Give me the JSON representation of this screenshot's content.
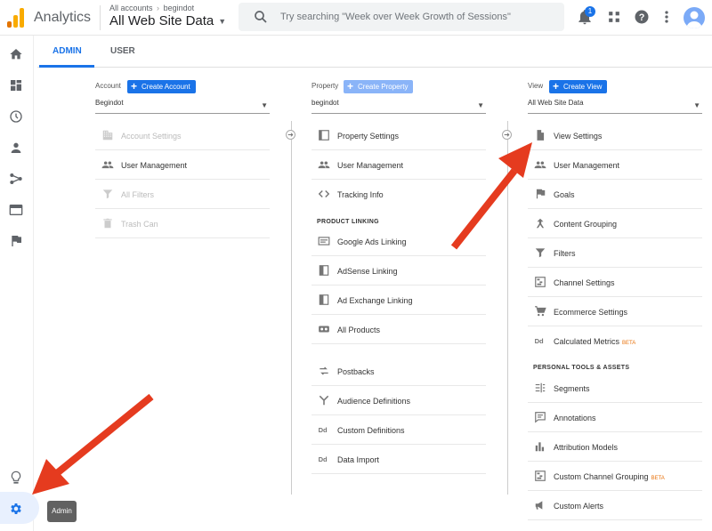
{
  "header": {
    "app_name": "Analytics",
    "breadcrumb_account": "All accounts",
    "breadcrumb_separator": "›",
    "breadcrumb_property": "begindot",
    "property_selector": "All Web Site Data",
    "search_placeholder": "Try searching \"Week over Week Growth of Sessions\"",
    "notification_count": "1"
  },
  "sidebar": {
    "tooltip": "Admin"
  },
  "tabs": [
    {
      "label": "ADMIN",
      "active": true
    },
    {
      "label": "USER",
      "active": false
    }
  ],
  "account": {
    "heading": "Account",
    "button": "Create Account",
    "selected": "Begindot",
    "items": [
      {
        "label": "Account Settings",
        "icon": "building-icon",
        "disabled": true
      },
      {
        "label": "User Management",
        "icon": "people-icon",
        "disabled": false
      },
      {
        "label": "All Filters",
        "icon": "filter-icon",
        "disabled": true
      },
      {
        "label": "Trash Can",
        "icon": "trash-icon",
        "disabled": true
      }
    ]
  },
  "property": {
    "heading": "Property",
    "button": "Create Property",
    "selected": "begindot",
    "items": [
      {
        "label": "Property Settings",
        "icon": "window-icon"
      },
      {
        "label": "User Management",
        "icon": "people-icon"
      },
      {
        "label": "Tracking Info",
        "icon": "code-icon"
      }
    ],
    "section_linking": "PRODUCT LINKING",
    "linking": [
      {
        "label": "Google Ads Linking",
        "icon": "ads-icon"
      },
      {
        "label": "AdSense Linking",
        "icon": "adsense-icon"
      },
      {
        "label": "Ad Exchange Linking",
        "icon": "adexchange-icon"
      },
      {
        "label": "All Products",
        "icon": "link-icon"
      }
    ],
    "more": [
      {
        "label": "Postbacks",
        "icon": "postback-icon"
      },
      {
        "label": "Audience Definitions",
        "icon": "audience-icon"
      },
      {
        "label": "Custom Definitions",
        "icon": "dd-icon"
      },
      {
        "label": "Data Import",
        "icon": "dd-icon"
      }
    ]
  },
  "view": {
    "heading": "View",
    "button": "Create View",
    "selected": "All Web Site Data",
    "items": [
      {
        "label": "View Settings",
        "icon": "document-icon",
        "beta": ""
      },
      {
        "label": "User Management",
        "icon": "people-icon",
        "beta": ""
      },
      {
        "label": "Goals",
        "icon": "flag-icon",
        "beta": ""
      },
      {
        "label": "Content Grouping",
        "icon": "grouping-icon",
        "beta": ""
      },
      {
        "label": "Filters",
        "icon": "filter-icon",
        "beta": ""
      },
      {
        "label": "Channel Settings",
        "icon": "channel-icon",
        "beta": ""
      },
      {
        "label": "Ecommerce Settings",
        "icon": "cart-icon",
        "beta": ""
      },
      {
        "label": "Calculated Metrics",
        "icon": "dd-icon",
        "beta": "BETA"
      }
    ],
    "section_tools": "PERSONAL TOOLS & ASSETS",
    "tools": [
      {
        "label": "Segments",
        "icon": "segments-icon",
        "beta": ""
      },
      {
        "label": "Annotations",
        "icon": "annotation-icon",
        "beta": ""
      },
      {
        "label": "Attribution Models",
        "icon": "bar-chart-icon",
        "beta": ""
      },
      {
        "label": "Custom Channel Grouping",
        "icon": "channel-icon",
        "beta": "BETA"
      },
      {
        "label": "Custom Alerts",
        "icon": "megaphone-icon",
        "beta": ""
      }
    ]
  },
  "colors": {
    "accent": "#1a73e8",
    "annotation_arrow": "#e53b1f"
  }
}
